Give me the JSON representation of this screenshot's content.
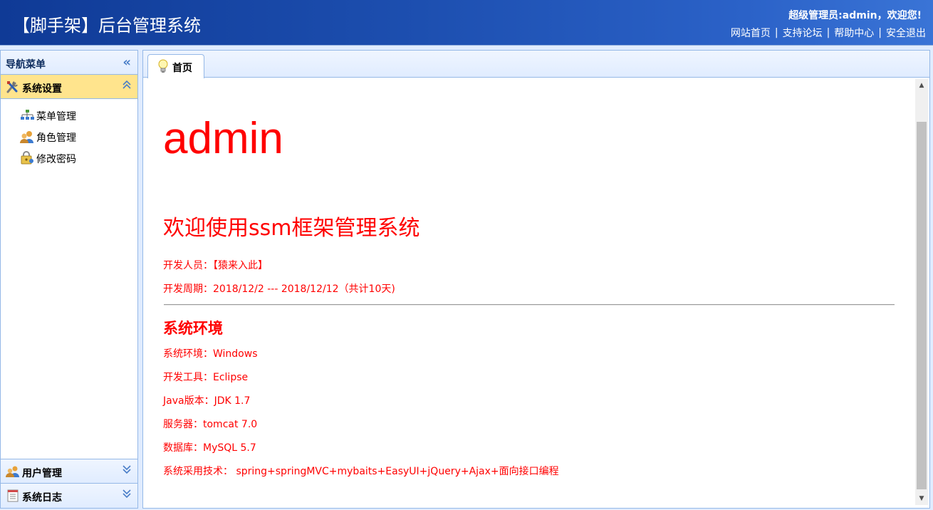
{
  "header": {
    "title": "【脚手架】后台管理系统",
    "welcome": "超级管理员:admin，欢迎您!",
    "links": [
      "网站首页",
      "支持论坛",
      "帮助中心",
      "安全退出"
    ],
    "separator": "|"
  },
  "sidebar": {
    "title": "导航菜单",
    "collapse_icon": "«",
    "sections": [
      {
        "label": "系统设置",
        "icon": "tools-icon",
        "expanded": true
      },
      {
        "label": "用户管理",
        "icon": "users-icon",
        "expanded": false
      },
      {
        "label": "系统日志",
        "icon": "log-icon",
        "expanded": false
      }
    ],
    "items": [
      {
        "label": "菜单管理",
        "icon": "sitemap-icon"
      },
      {
        "label": "角色管理",
        "icon": "role-icon"
      },
      {
        "label": "修改密码",
        "icon": "key-icon"
      }
    ]
  },
  "tabs": [
    {
      "label": "首页",
      "icon": "lightbulb-icon"
    }
  ],
  "content": {
    "username": "admin",
    "welcome_heading": "欢迎使用ssm框架管理系统",
    "developer": "开发人员：【猿来入此】",
    "period": "开发周期：2018/12/2 --- 2018/12/12（共计10天)",
    "env_heading": "系统环境",
    "env": [
      "系统环境：Windows",
      "开发工具：Eclipse",
      "Java版本：JDK 1.7",
      "服务器：tomcat 7.0",
      "数据库：MySQL 5.7",
      "系统采用技术： spring+springMVC+mybaits+EasyUI+jQuery+Ajax+面向接口编程"
    ]
  },
  "colors": {
    "accent_text": "#ff0000",
    "header_bg": "#1d4fb0",
    "active_section": "#ffe48d"
  }
}
